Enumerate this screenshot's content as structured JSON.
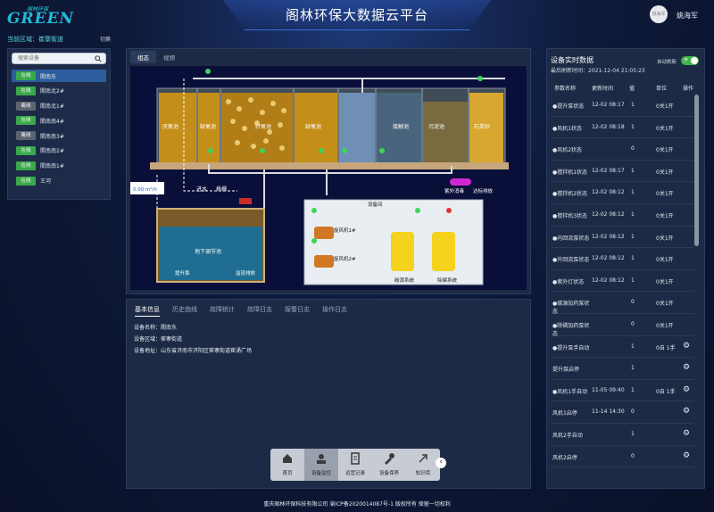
{
  "app": {
    "title": "阁林环保大数据云平台",
    "logo_small": "阁林环保",
    "logo_big": "GREEN",
    "avatar_text": "姚海军",
    "username": "姚海军"
  },
  "left": {
    "region_label": "当前区域：",
    "region_value": "崔寨街道",
    "switch": "切换",
    "search_placeholder": "搜索设备",
    "devices": [
      {
        "status": "在线",
        "name": "閤南东",
        "online": true,
        "selected": true
      },
      {
        "status": "在线",
        "name": "閤南北2#",
        "online": true,
        "selected": false
      },
      {
        "status": "离线",
        "name": "閤南北1#",
        "online": false,
        "selected": false
      },
      {
        "status": "在线",
        "name": "閤南南4#",
        "online": true,
        "selected": false
      },
      {
        "status": "离线",
        "name": "閤南南3#",
        "online": false,
        "selected": false
      },
      {
        "status": "在线",
        "name": "閤南南2#",
        "online": true,
        "selected": false
      },
      {
        "status": "在线",
        "name": "閤南南1#",
        "online": true,
        "selected": false
      },
      {
        "status": "在线",
        "name": "王河",
        "online": true,
        "selected": false
      }
    ]
  },
  "center": {
    "tabs": [
      "组态",
      "视频"
    ],
    "scene_labels": {
      "tank1": "厌氧池",
      "tank2": "缺氧池",
      "tank3": "好氧池",
      "tank4": "缺氧池",
      "tank5": "沉淀池",
      "tank6": "接触池",
      "tank7": "污泥池",
      "tank8": "石英砂",
      "uv": "紫外消毒",
      "outlet": "达标排放",
      "flow": "0.00 m³/h",
      "water_in": "进水",
      "grille": "格栅",
      "equal_pool": "地下调节池",
      "lift_pump": "提升泵",
      "overflow": "溢流排放",
      "equip_room": "设备间",
      "blower1": "旋风机1#",
      "blower2": "旋风机2#",
      "dosing1": "碳源系统",
      "dosing2": "除磷系统"
    },
    "info_tabs": [
      "基本信息",
      "历史曲线",
      "故障统计",
      "故障日志",
      "报警日志",
      "操作日志"
    ],
    "info": {
      "name": "设备名称：閤南东",
      "area": "设备区域：崔寨街道",
      "address": "设备地址：山东省济南市济阳区崔寨街道崔涌广场"
    },
    "dock": [
      "首页",
      "设备监控",
      "运营记录",
      "设备保养",
      "知识库"
    ]
  },
  "right": {
    "title": "设备实时数据",
    "time": "最后刷新时间：2021-12-04 21:05:23",
    "auto_label": "自动刷新",
    "toggle_text": "开",
    "headers": [
      "参数名称",
      "更新时间",
      "值",
      "单位",
      "操作"
    ],
    "rows": [
      {
        "name": "●提升泵状态",
        "time": "12-02 08:17",
        "value": "1",
        "unit": "0关1开",
        "op": false
      },
      {
        "name": "●风机1状态",
        "time": "12-02 08:18",
        "value": "1",
        "unit": "0关1开",
        "op": false
      },
      {
        "name": "●风机2状态",
        "time": "",
        "value": "0",
        "unit": "0关1开",
        "op": false
      },
      {
        "name": "●搅拌机1状态",
        "time": "12-02 08:17",
        "value": "1",
        "unit": "0关1开",
        "op": false
      },
      {
        "name": "●搅拌机2状态",
        "time": "12-02 08:12",
        "value": "1",
        "unit": "0关1开",
        "op": false
      },
      {
        "name": "●搅拌机3状态",
        "time": "12-02 08:12",
        "value": "1",
        "unit": "0关1开",
        "op": false
      },
      {
        "name": "●内回流泵状态",
        "time": "12-02 08:12",
        "value": "1",
        "unit": "0关1开",
        "op": false
      },
      {
        "name": "●外回流泵状态",
        "time": "12-02 08:12",
        "value": "1",
        "unit": "0关1开",
        "op": false
      },
      {
        "name": "●紫外灯状态",
        "time": "12-02 08:12",
        "value": "1",
        "unit": "0关1开",
        "op": false
      },
      {
        "name": "●碳源加药泵状态",
        "time": "",
        "value": "0",
        "unit": "0关1开",
        "op": false
      },
      {
        "name": "●除磷加药泵状态",
        "time": "",
        "value": "0",
        "unit": "0关1开",
        "op": false
      },
      {
        "name": "●提升泵手自动",
        "time": "",
        "value": "1",
        "unit": "0自 1手",
        "op": true
      },
      {
        "name": "提升泵启停",
        "time": "",
        "value": "1",
        "unit": "",
        "op": true
      },
      {
        "name": "●风机1手自动",
        "time": "11-05 09:40",
        "value": "1",
        "unit": "0自 1手",
        "op": true
      },
      {
        "name": "风机1启停",
        "time": "11-14 14:30",
        "value": "0",
        "unit": "",
        "op": true
      },
      {
        "name": "风机2手自动",
        "time": "",
        "value": "1",
        "unit": "",
        "op": true
      },
      {
        "name": "风机2启停",
        "time": "",
        "value": "0",
        "unit": "",
        "op": true
      }
    ]
  },
  "footer": "重庆阁林环保科技有限公司 渝ICP备2020014087号-1 版权所有 保留一切权利"
}
